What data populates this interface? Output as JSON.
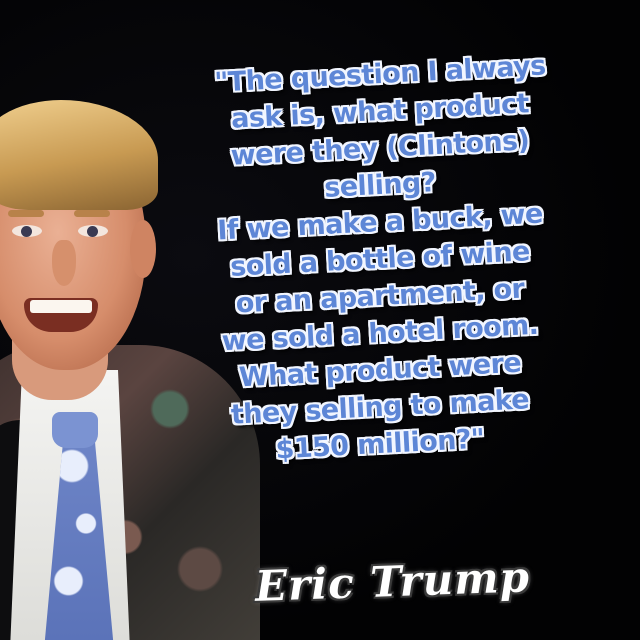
{
  "quote": {
    "lines": [
      "\"The question I always",
      "ask is, what product",
      "were they (Clintons)",
      "selling?",
      "If we make a buck, we",
      "sold a bottle of wine",
      "or an apartment, or",
      "we sold a hotel room.",
      "What product were",
      "they selling to make",
      "$150 million?\""
    ],
    "color": "#5d86d6",
    "outline_color": "#f2f6ff"
  },
  "signature": {
    "text": "Eric Trump",
    "color": "#ffffff"
  },
  "background_color": "#030305"
}
